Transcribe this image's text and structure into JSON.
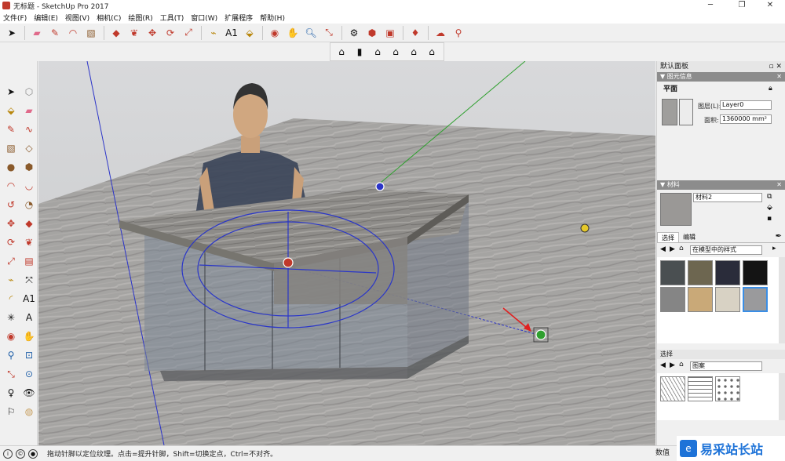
{
  "window": {
    "title": "无标题 - SketchUp Pro 2017"
  },
  "menu": [
    "文件(F)",
    "编辑(E)",
    "视图(V)",
    "相机(C)",
    "绘图(R)",
    "工具(T)",
    "窗口(W)",
    "扩展程序",
    "帮助(H)"
  ],
  "toolbar_icons": [
    "select-icon",
    "eraser-icon",
    "pencil-icon",
    "arc-icon",
    "rectangle-icon",
    "pushpull-icon",
    "followme-icon",
    "move-icon",
    "rotate-icon",
    "scale-icon",
    "tape-icon",
    "text-icon",
    "paint-icon",
    "orbit-icon",
    "pan-icon",
    "zoom-icon",
    "zoomext-icon",
    "warehouse-icon",
    "extension-icon",
    "layout-icon",
    "ruby-icon",
    "cloud-icon",
    "map-icon"
  ],
  "view_icons": [
    "iso-view-icon",
    "top-view-icon",
    "front-view-icon",
    "right-view-icon",
    "back-view-icon",
    "left-view-icon"
  ],
  "panel": {
    "title": "默认面板",
    "entity_info": {
      "header": "图元信息",
      "type": "平面",
      "layer_label": "图层(L):",
      "layer_value": "Layer0",
      "area_label": "面积:",
      "area_value": "1360000 mm²"
    },
    "materials": {
      "header": "材料",
      "name": "材料2",
      "tabs": [
        "选择",
        "编辑"
      ],
      "collection": "在模型中的样式",
      "swatches": [
        "#4a4f51",
        "#6d6650",
        "#2a2c3a",
        "#141414",
        "#858585",
        "#c9a978",
        "#d8d2c4",
        "#9a9a9c"
      ],
      "secondary_header": "选择",
      "secondary_collection": "图案"
    }
  },
  "status": {
    "text": "拖动针脚以定位纹理。点击=提升针脚，Shift=切换定点，Ctrl=不对齐。",
    "measure_label": "数值"
  },
  "watermark": "易采站长站"
}
